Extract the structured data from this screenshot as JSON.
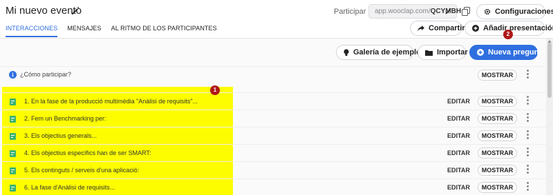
{
  "header": {
    "title": "Mi nuevo evento",
    "join_label": "Participar a:",
    "join_domain": "app.wooclap.com/",
    "join_code": "QCYMBH",
    "config_label": "Configuraciones",
    "share_label": "Compartir",
    "add_presentation_label": "Añadir presentación"
  },
  "tabs": [
    {
      "label": "INTERACCIONES",
      "active": true
    },
    {
      "label": "MENSAJES",
      "active": false
    },
    {
      "label": "AL RITMO DE LOS PARTICIPANTES",
      "active": false
    }
  ],
  "toolbar": {
    "gallery_label": "Galería de ejemplos",
    "import_label": "Importar",
    "new_question_label": "Nueva pregunta"
  },
  "how_to": {
    "label": "¿Cómo participar?",
    "show_label": "MOSTRAR"
  },
  "questions": [
    {
      "text": "1.  En la fase de la producció multimèdia \"Anàlisi de requisits\"...",
      "edit": "EDITAR",
      "show": "MOSTRAR"
    },
    {
      "text": "2.  Fem un Benchmarking per:",
      "edit": "EDITAR",
      "show": "MOSTRAR"
    },
    {
      "text": "3.  Els objectius generals...",
      "edit": "EDITAR",
      "show": "MOSTRAR"
    },
    {
      "text": "4.  Els objectius específics han de ser SMART:",
      "edit": "EDITAR",
      "show": "MOSTRAR"
    },
    {
      "text": "5.  Els continguts / serveis d'una aplicació:",
      "edit": "EDITAR",
      "show": "MOSTRAR"
    },
    {
      "text": "6.  La fase d'Anàlisi de requisits...",
      "edit": "EDITAR",
      "show": "MOSTRAR"
    }
  ],
  "annotations": {
    "marker_1": "1",
    "marker_2": "2"
  },
  "colors": {
    "accent": "#2f6fe0",
    "highlight": "#fdfd00",
    "marker": "#b01818",
    "question_icon": "#3cb371"
  },
  "icons": [
    "pencil-icon",
    "copy-icon",
    "gear-icon",
    "share-icon",
    "plus-circle-icon",
    "lightbulb-icon",
    "folder-icon",
    "info-icon",
    "poll-icon",
    "kebab-icon"
  ]
}
